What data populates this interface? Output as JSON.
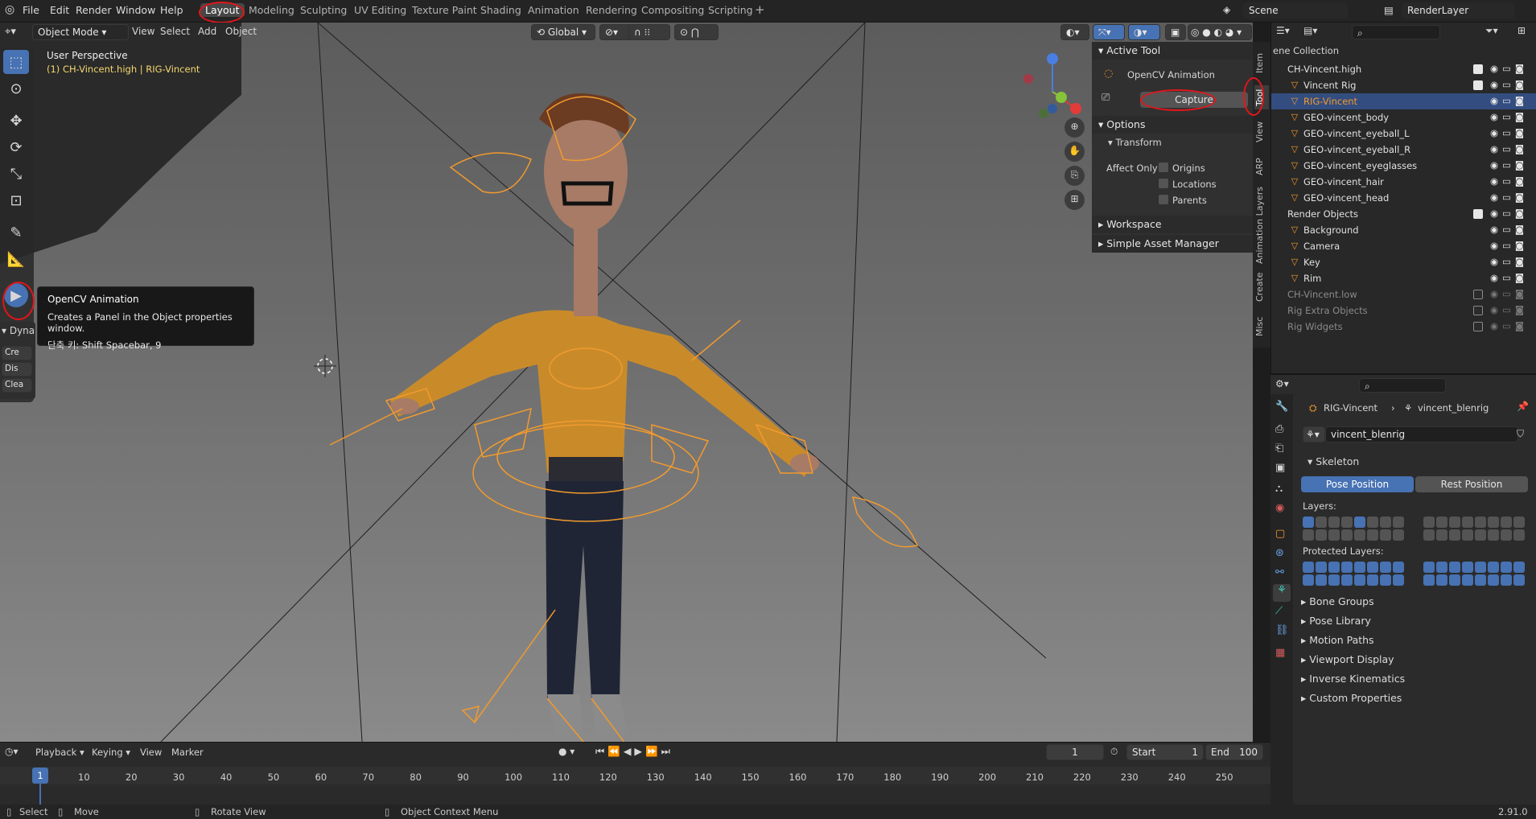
{
  "menu": {
    "file": "File",
    "edit": "Edit",
    "render": "Render",
    "window": "Window",
    "help": "Help"
  },
  "workspaces": [
    "Layout",
    "Modeling",
    "Sculpting",
    "UV Editing",
    "Texture Paint",
    "Shading",
    "Animation",
    "Rendering",
    "Compositing",
    "Scripting"
  ],
  "scene": {
    "name": "Scene",
    "view_layer": "RenderLayer"
  },
  "viewport_header": {
    "mode": "Object Mode",
    "view": "View",
    "select": "Select",
    "add": "Add",
    "object": "Object",
    "orientation": "Global"
  },
  "viewport": {
    "perspective": "User Perspective",
    "object_label": "(1) CH-Vincent.high | RIG-Vincent"
  },
  "tooltip": {
    "title": "OpenCV Animation",
    "description": "Creates a Panel in the Object properties window.",
    "shortcut": "단축 키: Shift Spacebar, 9"
  },
  "dyna_panel": {
    "title": "Dyna",
    "btn1": "Cre",
    "btn2": "Dis",
    "btn3": "Clea"
  },
  "npanel": {
    "active_tool_header": "Active Tool",
    "active_tool_name": "OpenCV Animation",
    "capture_label": "Capture",
    "options_header": "Options",
    "transform_header": "Transform",
    "affect_only": "Affect Only",
    "origins": "Origins",
    "locations": "Locations",
    "parents": "Parents",
    "workspace": "Workspace",
    "simple_asset": "Simple Asset Manager"
  },
  "side_tabs": [
    "Item",
    "Tool",
    "View",
    "ARP",
    "Animation Layers",
    "Create",
    "Misc"
  ],
  "outliner": {
    "header": "ene Collection",
    "rows": [
      {
        "name": "CH-Vincent.high",
        "indent": 0,
        "checked": true
      },
      {
        "name": "Vincent Rig",
        "indent": 1,
        "checked": true
      },
      {
        "name": "RIG-Vincent",
        "indent": 1,
        "selected": true
      },
      {
        "name": "GEO-vincent_body",
        "indent": 1
      },
      {
        "name": "GEO-vincent_eyeball_L",
        "indent": 1
      },
      {
        "name": "GEO-vincent_eyeball_R",
        "indent": 1
      },
      {
        "name": "GEO-vincent_eyeglasses",
        "indent": 1
      },
      {
        "name": "GEO-vincent_hair",
        "indent": 1
      },
      {
        "name": "GEO-vincent_head",
        "indent": 1
      },
      {
        "name": "Render Objects",
        "indent": 0,
        "checked": true
      },
      {
        "name": "Background",
        "indent": 1
      },
      {
        "name": "Camera",
        "indent": 1
      },
      {
        "name": "Key",
        "indent": 1
      },
      {
        "name": "Rim",
        "indent": 1
      },
      {
        "name": "CH-Vincent.low",
        "indent": 0,
        "dim": true
      },
      {
        "name": "Rig Extra Objects",
        "indent": 0,
        "dim": true
      },
      {
        "name": "Rig Widgets",
        "indent": 0,
        "dim": true
      }
    ]
  },
  "properties": {
    "breadcrumb_object": "RIG-Vincent",
    "breadcrumb_data": "vincent_blenrig",
    "datablock": "vincent_blenrig",
    "skeleton": "Skeleton",
    "pose_position": "Pose Position",
    "rest_position": "Rest Position",
    "layers": "Layers:",
    "protected_layers": "Protected Layers:",
    "sections": [
      "Bone Groups",
      "Pose Library",
      "Motion Paths",
      "Viewport Display",
      "Inverse Kinematics",
      "Custom Properties"
    ]
  },
  "timeline": {
    "playback": "Playback",
    "keying": "Keying",
    "view": "View",
    "marker": "Marker",
    "current_frame": "1",
    "start_label": "Start",
    "start": "1",
    "end_label": "End",
    "end": "100",
    "ticks": [
      "1",
      "10",
      "20",
      "30",
      "40",
      "50",
      "60",
      "70",
      "80",
      "90",
      "100",
      "110",
      "120",
      "130",
      "140",
      "150",
      "160",
      "170",
      "180",
      "190",
      "200",
      "210",
      "220",
      "230",
      "240",
      "250"
    ]
  },
  "status": {
    "select": "Select",
    "move": "Move",
    "rotate": "Rotate View",
    "context": "Object Context Menu",
    "version": "2.91.0"
  },
  "colors": {
    "accent": "#4772b3",
    "rig": "#f29a2e",
    "annotation": "#e0161b"
  }
}
